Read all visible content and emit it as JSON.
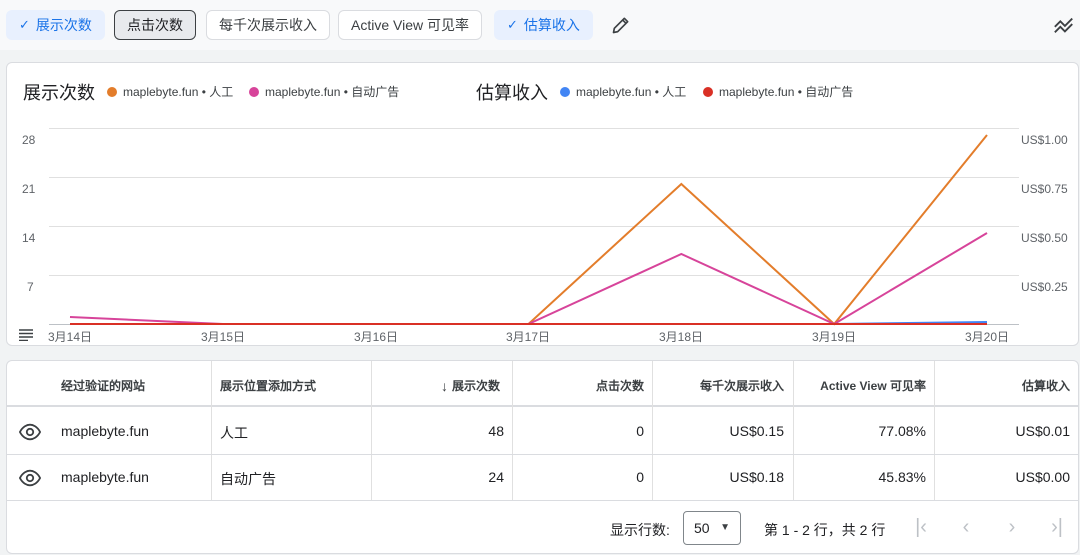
{
  "chips": [
    {
      "label": "展示次数",
      "selected": true
    },
    {
      "label": "点击次数",
      "selected": false
    },
    {
      "label": "每千次展示收入",
      "selected": false
    },
    {
      "label": "Active View 可见率",
      "selected": false
    },
    {
      "label": "估算收入",
      "selected": true
    }
  ],
  "chart": {
    "left_title": "展示次数",
    "right_title": "估算收入",
    "legend": [
      {
        "label": "maplebyte.fun • 人工",
        "color": "#e37d2b"
      },
      {
        "label": "maplebyte.fun • 自动广告",
        "color": "#d7449a"
      },
      {
        "label": "maplebyte.fun • 人工",
        "color": "#4285f4"
      },
      {
        "label": "maplebyte.fun • 自动广告",
        "color": "#d93025"
      }
    ],
    "y_left_ticks": [
      "28",
      "21",
      "14",
      "7"
    ],
    "y_right_ticks": [
      "US$1.00",
      "US$0.75",
      "US$0.50",
      "US$0.25"
    ]
  },
  "chart_data": {
    "type": "line",
    "x": [
      "3月14日",
      "3月15日",
      "3月16日",
      "3月17日",
      "3月18日",
      "3月19日",
      "3月20日"
    ],
    "ylim_left": [
      0,
      28
    ],
    "ylim_right": [
      0,
      1.0
    ],
    "series": [
      {
        "name": "maplebyte.fun • 人工",
        "axis": "left",
        "color": "#e37d2b",
        "values": [
          0,
          0,
          0,
          0,
          20,
          0,
          27
        ]
      },
      {
        "name": "maplebyte.fun • 自动广告",
        "axis": "left",
        "color": "#d7449a",
        "values": [
          1,
          0,
          0,
          0,
          10,
          0,
          13
        ]
      },
      {
        "name": "maplebyte.fun • 人工",
        "axis": "right",
        "color": "#4285f4",
        "values": [
          0,
          0,
          0,
          0,
          0,
          0,
          0.01
        ]
      },
      {
        "name": "maplebyte.fun • 自动广告",
        "axis": "right",
        "color": "#d93025",
        "values": [
          0,
          0,
          0,
          0,
          0,
          0,
          0
        ]
      }
    ]
  },
  "table": {
    "headers": [
      "经过验证的网站",
      "展示位置添加方式",
      "展示次数",
      "点击次数",
      "每千次展示收入",
      "Active View 可见率",
      "估算收入"
    ],
    "sort_icon": "arrow-down-icon",
    "rows": [
      [
        "maplebyte.fun",
        "人工",
        "48",
        "0",
        "US$0.15",
        "77.08%",
        "US$0.01"
      ],
      [
        "maplebyte.fun",
        "自动广告",
        "24",
        "0",
        "US$0.18",
        "45.83%",
        "US$0.00"
      ]
    ],
    "footer": {
      "rows_label": "显示行数:",
      "rows_value": "50",
      "range_text": "第 1 - 2 行，共 2 行"
    }
  }
}
